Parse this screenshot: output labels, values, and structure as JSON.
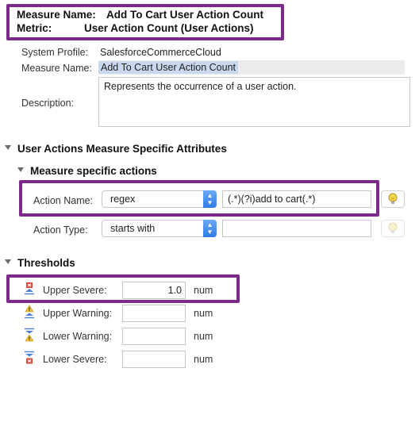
{
  "header": {
    "measure_name_label": "Measure Name:",
    "measure_name_value": "Add To Cart User Action Count",
    "metric_label": "Metric:",
    "metric_value": "User Action Count (User Actions)"
  },
  "details": {
    "system_profile_label": "System Profile:",
    "system_profile_value": "SalesforceCommerceCloud",
    "measure_name_label": "Measure Name:",
    "measure_name_value": "Add To Cart User Action Count",
    "description_label": "Description:",
    "description_value": "Represents the occurrence of a user action."
  },
  "sections": {
    "attributes_title": "User Actions Measure Specific Attributes",
    "actions_title": "Measure specific actions",
    "thresholds_title": "Thresholds"
  },
  "actions": {
    "action_name_label": "Action Name:",
    "action_name_operator": "regex",
    "action_name_value": "(.*)(?i)add to cart(.*)",
    "action_type_label": "Action Type:",
    "action_type_operator": "starts with",
    "action_type_value": ""
  },
  "thresholds": [
    {
      "label": "Upper Severe:",
      "value": "1.0",
      "unit": "num",
      "icon": "upper-severe-icon"
    },
    {
      "label": "Upper Warning:",
      "value": "",
      "unit": "num",
      "icon": "upper-warning-icon"
    },
    {
      "label": "Lower Warning:",
      "value": "",
      "unit": "num",
      "icon": "lower-warning-icon"
    },
    {
      "label": "Lower Severe:",
      "value": "",
      "unit": "num",
      "icon": "lower-severe-icon"
    }
  ],
  "colors": {
    "highlight": "#7b2a8c",
    "selection": "#c9d8ef",
    "select_button": "#2f7ce8"
  }
}
